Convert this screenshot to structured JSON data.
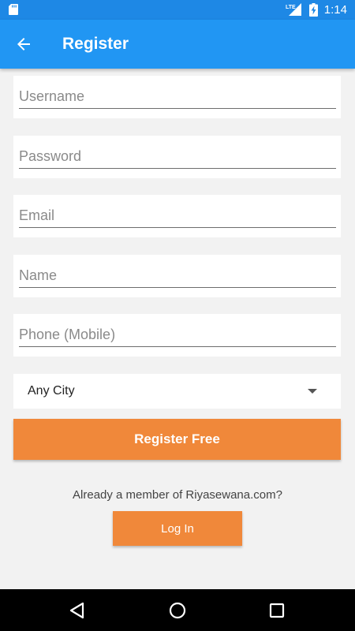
{
  "status_bar": {
    "time": "1:14",
    "network": "LTE",
    "icons": [
      "sd-card-icon",
      "signal-icon",
      "battery-charging-icon"
    ]
  },
  "app_bar": {
    "title": "Register",
    "back_icon": "arrow-back-icon"
  },
  "form": {
    "username_placeholder": "Username",
    "username_value": "",
    "password_placeholder": "Password",
    "password_value": "",
    "email_placeholder": "Email",
    "email_value": "",
    "name_placeholder": "Name",
    "name_value": "",
    "phone_placeholder": "Phone (Mobile)",
    "phone_value": "",
    "city_selected": "Any City"
  },
  "actions": {
    "register_label": "Register Free",
    "member_prompt": "Already a member of Riyasewana.com?",
    "login_label": "Log In"
  },
  "colors": {
    "status_bar": "#1e88e5",
    "app_bar": "#2196f3",
    "accent_button": "#f0883a",
    "background": "#f2f2f2"
  },
  "nav_bar": {
    "icons": [
      "back-triangle-icon",
      "home-circle-icon",
      "recents-square-icon"
    ]
  }
}
